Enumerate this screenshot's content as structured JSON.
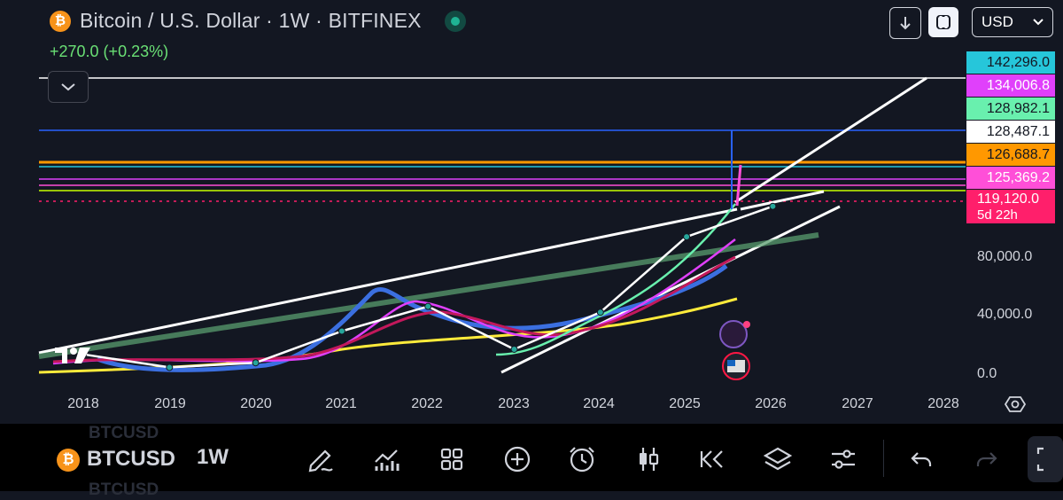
{
  "header": {
    "symbol_icon": "bitcoin-icon",
    "title": "Bitcoin / U.S. Dollar · 1W · BITFINEX",
    "change": "+270.0 (+0.23%)",
    "currency": "USD"
  },
  "price_tags": [
    {
      "value": "142,296.0",
      "color": "#26c6da"
    },
    {
      "value": "134,006.8",
      "color": "#e040fb"
    },
    {
      "value": "128,982.1",
      "color": "#69f0ae"
    },
    {
      "value": "128,487.1",
      "color": "#ffffff"
    },
    {
      "value": "126,688.7",
      "color": "#ff9800"
    },
    {
      "value": "125,369.2",
      "color": "#ff4fd8"
    },
    {
      "value": "119,120.0",
      "countdown": "5d 22h",
      "color": "#ff1f6b"
    }
  ],
  "yaxis": {
    "labels": [
      "80,000.0",
      "40,000.0",
      "0.0"
    ]
  },
  "xaxis": {
    "labels": [
      "2018",
      "2019",
      "2020",
      "2021",
      "2022",
      "2023",
      "2024",
      "2025",
      "2026",
      "2027",
      "2028"
    ]
  },
  "chart_data": {
    "type": "line",
    "title": "Bitcoin / U.S. Dollar · 1W · BITFINEX",
    "x": [
      "2018",
      "2019",
      "2020",
      "2021",
      "2022",
      "2023",
      "2024",
      "2025",
      "2026",
      "2027",
      "2028"
    ],
    "ylim": [
      0,
      150000
    ],
    "series": [
      {
        "values": [
          13000,
          4000,
          7200,
          29000,
          46000,
          16500,
          42000,
          94000,
          115000,
          null,
          null
        ]
      }
    ],
    "horizontal_levels": [
      142296.0,
      134006.8,
      128982.1,
      128487.1,
      126688.7,
      125369.2,
      119120.0
    ]
  },
  "bottom_bar": {
    "symbol": "BTCUSD",
    "interval": "1W",
    "tools": [
      "drawing-pen-icon",
      "indicators-icon",
      "grid-layout-icon",
      "add-icon",
      "alert-clock-icon",
      "candles-icon",
      "replay-icon",
      "layers-icon",
      "settings-sliders-icon",
      "undo-icon",
      "redo-icon"
    ]
  }
}
